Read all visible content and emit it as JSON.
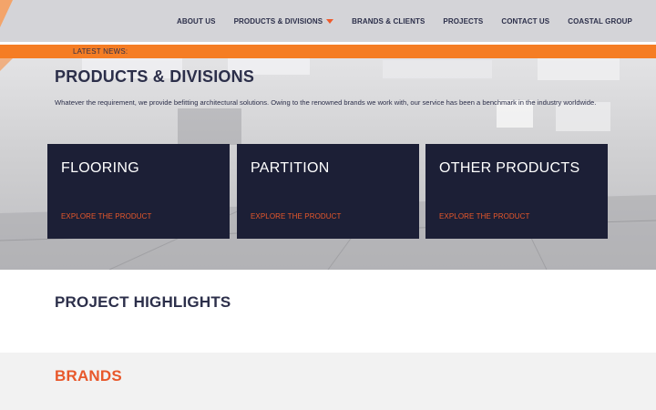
{
  "colors": {
    "navy": "#1c1f36",
    "text": "#2c2f4a",
    "accent": "#e8582b",
    "news_bar": "#f57d24",
    "header_bg": "#d4d4d8"
  },
  "nav": {
    "items": [
      {
        "label": "ABOUT US"
      },
      {
        "label": "PRODUCTS & DIVISIONS",
        "icon": "caret-down-icon"
      },
      {
        "label": "BRANDS & CLIENTS"
      },
      {
        "label": "PROJECTS"
      },
      {
        "label": "CONTACT US"
      },
      {
        "label": "COASTAL GROUP"
      }
    ]
  },
  "news": {
    "label": "LATEST NEWS:"
  },
  "hero": {
    "title": "PRODUCTS & DIVISIONS",
    "description": "Whatever the requirement, we provide befitting architectural solutions. Owing to the renowned brands we work with, our service has been a benchmark in the industry worldwide."
  },
  "cards": [
    {
      "title": "FLOORING",
      "link": "EXPLORE THE PRODUCT"
    },
    {
      "title": "PARTITION",
      "link": "EXPLORE THE PRODUCT"
    },
    {
      "title": "OTHER PRODUCTS",
      "link": "EXPLORE THE PRODUCT"
    }
  ],
  "sections": {
    "highlights_title": "PROJECT HIGHLIGHTS",
    "brands_title": "BRANDS"
  }
}
